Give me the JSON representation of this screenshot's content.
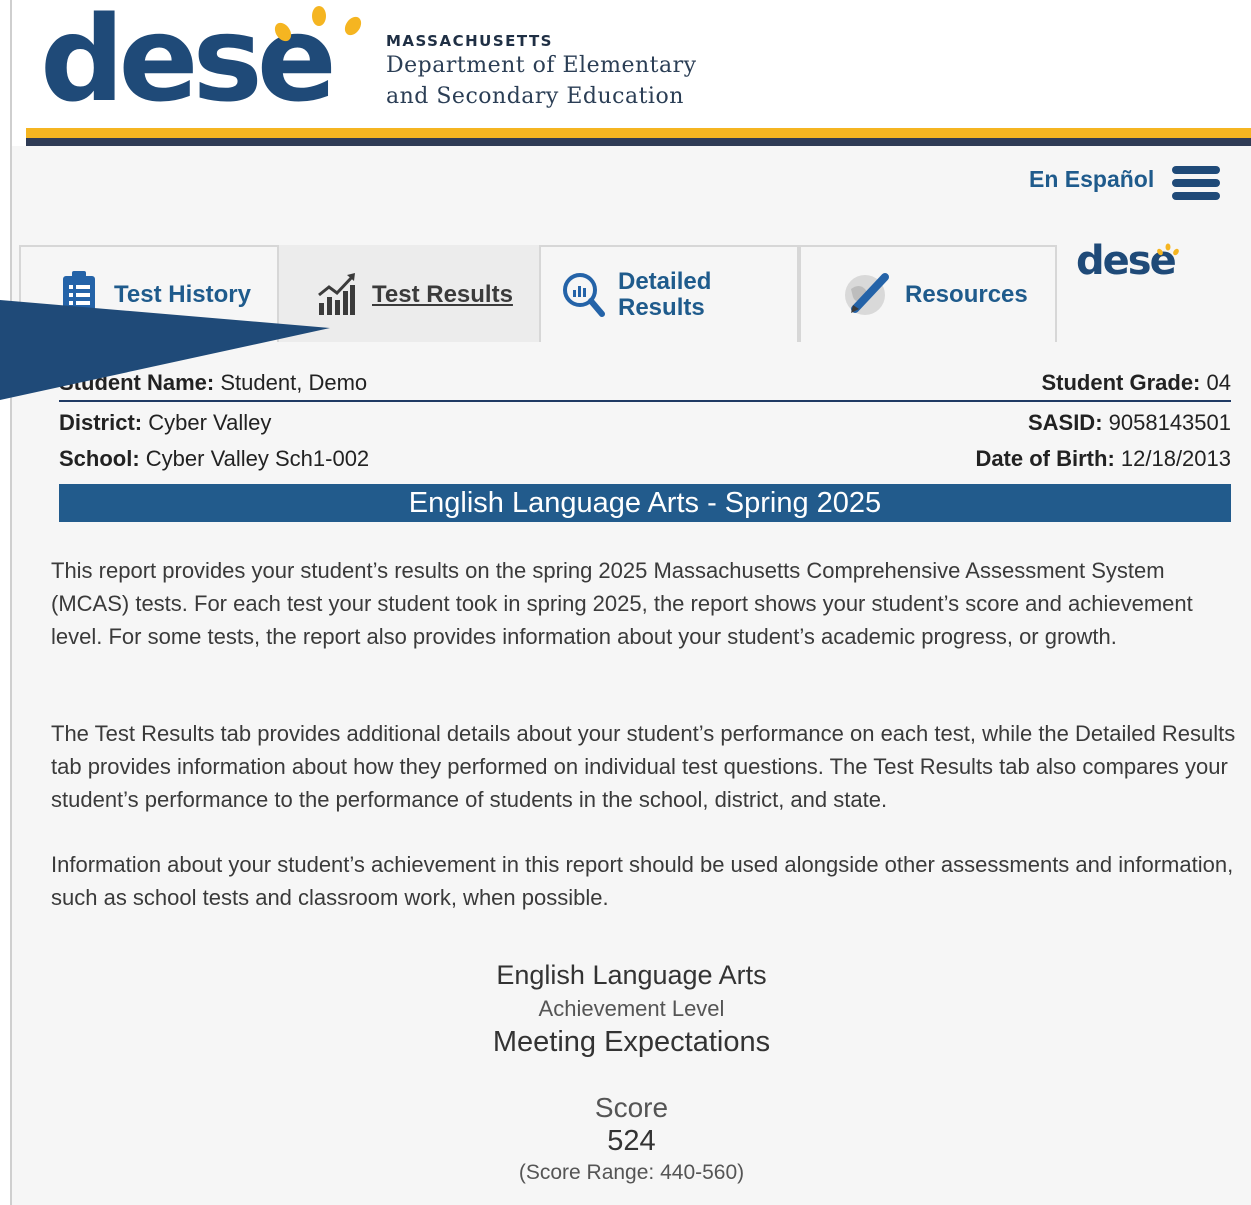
{
  "header": {
    "logo_text": "dese",
    "state": "MASSACHUSETTS",
    "dept_line1": "Department of Elementary",
    "dept_line2": "and Secondary Education",
    "colors": {
      "navy": "#1f4a78",
      "gold": "#f5b521"
    }
  },
  "nav": {
    "language_link": "En Español",
    "menu_icon": "hamburger-menu-icon"
  },
  "tabs": [
    {
      "label": "Test History",
      "icon": "clipboard-icon",
      "active": false
    },
    {
      "label": "Test Results",
      "icon": "bar-chart-icon",
      "active": true
    },
    {
      "label_line1": "Detailed",
      "label_line2": "Results",
      "icon": "magnify-chart-icon",
      "active": false
    },
    {
      "label": "Resources",
      "icon": "globe-pencil-icon",
      "active": false
    }
  ],
  "side_logo": "dese",
  "student": {
    "name_label": "Student Name:",
    "name": "Student, Demo",
    "grade_label": "Student Grade:",
    "grade": "04",
    "district_label": "District:",
    "district": "Cyber Valley",
    "sasid_label": "SASID:",
    "sasid": "9058143501",
    "school_label": "School:",
    "school": "Cyber Valley Sch1-002",
    "dob_label": "Date of Birth:",
    "dob": "12/18/2013"
  },
  "subject_banner": "English Language Arts - Spring 2025",
  "paragraphs": [
    "This report provides your student’s results on the spring 2025 Massachusetts Comprehensive Assessment System (MCAS) tests. For each test your student took in spring 2025, the report shows your student’s score and achievement level. For some tests, the report also provides information about your student’s academic progress, or growth.",
    "The Test Results tab provides additional details about your student’s performance on each test, while the Detailed Results tab provides information about how they performed on individual test questions. The Test Results tab also compares your student’s performance to the performance of students in the school, district, and state.",
    "Information about your student’s achievement in this report should be used alongside other assessments and information, such as school tests and classroom work, when possible."
  ],
  "result": {
    "subject": "English Language Arts",
    "level_label": "Achievement Level",
    "level": "Meeting Expectations",
    "score_label": "Score",
    "score": "524",
    "range": "(Score Range: 440-560)"
  }
}
